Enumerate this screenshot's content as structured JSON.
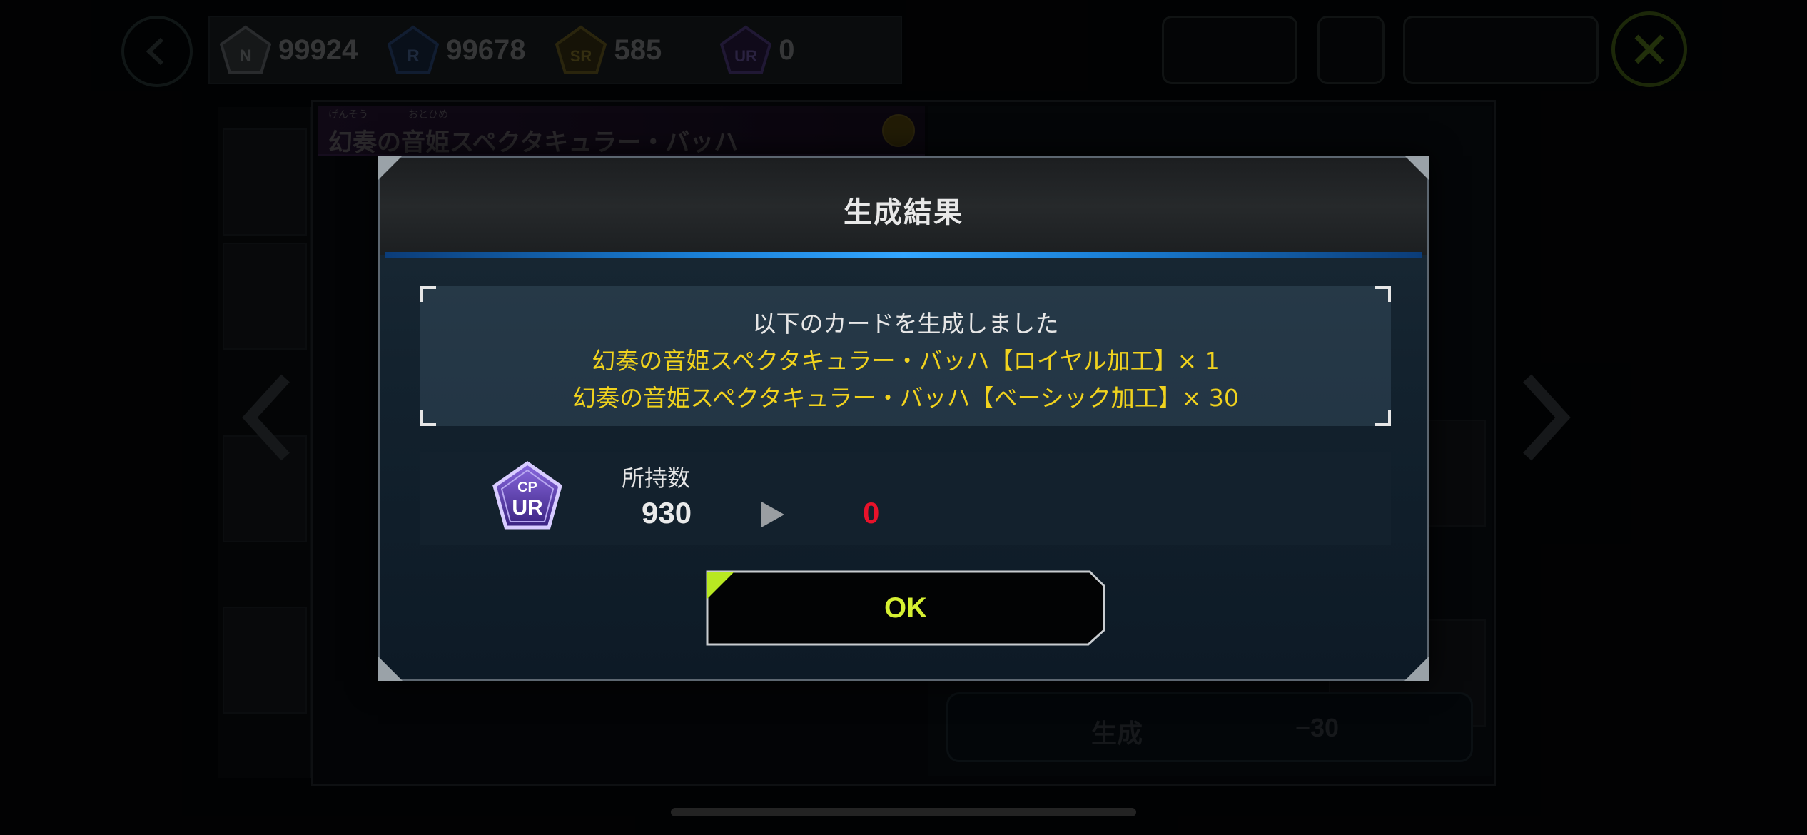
{
  "colors": {
    "accent_yellow": "#f0d21e",
    "ok_text": "#d6f032",
    "after_red": "#e8122a",
    "header_blue_line": "#33a6ff"
  },
  "header": {
    "back_icon": "chevron-left-icon",
    "cp": [
      {
        "rank": "N",
        "value": "99924",
        "icon": "cp-n-gem-icon"
      },
      {
        "rank": "R",
        "value": "99678",
        "icon": "cp-r-gem-icon"
      },
      {
        "rank": "SR",
        "value": "585",
        "icon": "cp-sr-gem-icon"
      },
      {
        "rank": "UR",
        "value": "0",
        "icon": "cp-ur-gem-icon"
      }
    ],
    "close_icon": "close-icon"
  },
  "background": {
    "card_furigana_1": "げんそう",
    "card_furigana_2": "おとひめ",
    "card_name": "幻奏の音姫スペクタキュラー・バッハ",
    "generate_label": "生成",
    "generate_cost": "−30"
  },
  "dialog": {
    "title": "生成結果",
    "message": "以下のカードを生成しました",
    "result_lines": [
      "幻奏の音姫スペクタキュラー・バッハ【ロイヤル加工】× 1",
      "幻奏の音姫スペクタキュラー・バッハ【ベーシック加工】× 30"
    ],
    "owned": {
      "label": "所持数",
      "before": "930",
      "after": "0",
      "icon": "cp-ur-gem-icon"
    },
    "ok_label": "OK"
  }
}
